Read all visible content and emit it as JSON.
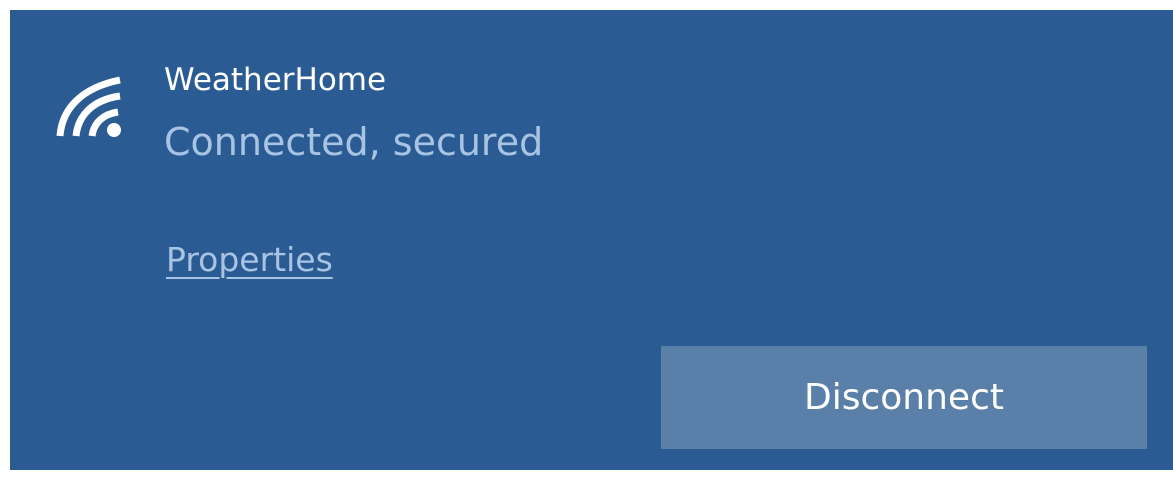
{
  "network": {
    "icon": "wifi-icon",
    "name": "WeatherHome",
    "status": "Connected, secured"
  },
  "links": {
    "properties_label": "Properties"
  },
  "actions": {
    "disconnect_label": "Disconnect"
  },
  "colors": {
    "panel_background": "#2b5b93",
    "secondary_text": "#a8c4e4",
    "button_background": "#5a7fa8",
    "primary_text": "#ffffff"
  }
}
